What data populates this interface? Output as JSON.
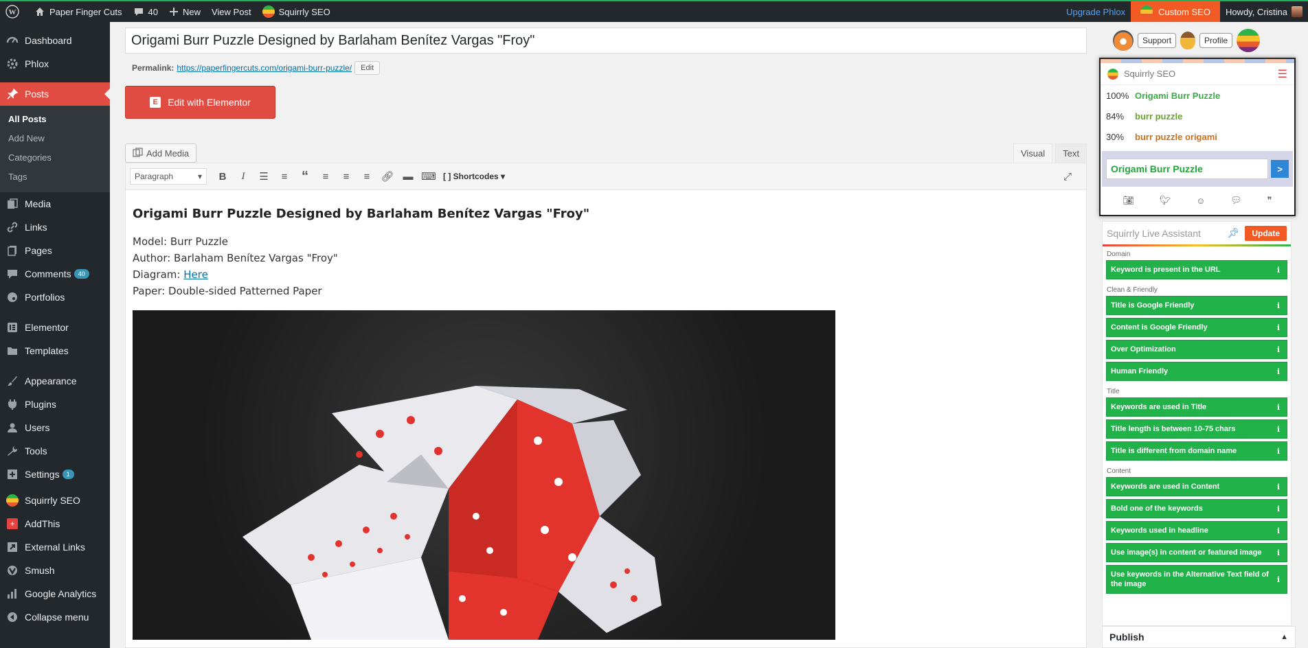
{
  "adminbar": {
    "site_name": "Paper Finger Cuts",
    "comments_count": "40",
    "new_label": "New",
    "view_post": "View Post",
    "squirrly": "Squirrly SEO",
    "upgrade": "Upgrade Phlox",
    "custom_seo": "Custom SEO",
    "howdy": "Howdy, Cristina"
  },
  "sidebar": {
    "dashboard": "Dashboard",
    "phlox": "Phlox",
    "posts": "Posts",
    "posts_sub": [
      "All Posts",
      "Add New",
      "Categories",
      "Tags"
    ],
    "media": "Media",
    "links": "Links",
    "pages": "Pages",
    "comments": "Comments",
    "comments_badge": "40",
    "portfolios": "Portfolios",
    "elementor": "Elementor",
    "templates": "Templates",
    "appearance": "Appearance",
    "plugins": "Plugins",
    "users": "Users",
    "tools": "Tools",
    "settings": "Settings",
    "settings_badge": "1",
    "squirrly": "Squirrly SEO",
    "addthis": "AddThis",
    "external_links": "External Links",
    "smush": "Smush",
    "google_analytics": "Google Analytics",
    "collapse": "Collapse menu"
  },
  "editor": {
    "title": "Origami Burr Puzzle Designed by Barlaham Benítez Vargas \"Froy\"",
    "permalink_label": "Permalink:",
    "permalink_url": "https://paperfingercuts.com/origami-burr-puzzle/",
    "edit_label": "Edit",
    "elementor_button": "Edit with Elementor",
    "add_media": "Add Media",
    "tab_visual": "Visual",
    "tab_text": "Text",
    "format_select": "Paragraph",
    "shortcodes": "Shortcodes",
    "content_heading": "Origami Burr Puzzle Designed by Barlaham Benítez Vargas \"Froy\"",
    "model": "Model: Burr Puzzle",
    "author": "Author: Barlaham Benítez Vargas \"Froy\"",
    "diagram_label": "Diagram:",
    "diagram_link": "Here",
    "paper": "Paper: Double-sided Patterned Paper"
  },
  "topright": {
    "support": "Support",
    "profile": "Profile"
  },
  "squirrly_box": {
    "title": "Squirrly SEO",
    "keywords": [
      {
        "pct": "100%",
        "kw": "Origami Burr Puzzle",
        "color": "#3aae44"
      },
      {
        "pct": "84%",
        "kw": "burr puzzle",
        "color": "#6aa32b"
      },
      {
        "pct": "30%",
        "kw": "burr puzzle origami",
        "color": "#c9701e"
      }
    ],
    "input_value": "Origami Burr Puzzle",
    "go": ">"
  },
  "live_assistant": {
    "title": "Squirrly Live Assistant",
    "update": "Update",
    "sections": [
      {
        "name": "Domain",
        "items": [
          "Keyword is present in the URL"
        ]
      },
      {
        "name": "Clean & Friendly",
        "items": [
          "Title is Google Friendly",
          "Content is Google Friendly",
          "Over Optimization",
          "Human Friendly"
        ]
      },
      {
        "name": "Title",
        "items": [
          "Keywords are used in Title",
          "Title length is between 10-75 chars",
          "Title is different from domain name"
        ]
      },
      {
        "name": "Content",
        "items": [
          "Keywords are used in Content",
          "Bold one of the keywords",
          "Keywords used in headline",
          "Use image(s) in content or featured image",
          "Use keywords in the Alternative Text field of the image"
        ]
      }
    ]
  },
  "publish": {
    "title": "Publish"
  }
}
